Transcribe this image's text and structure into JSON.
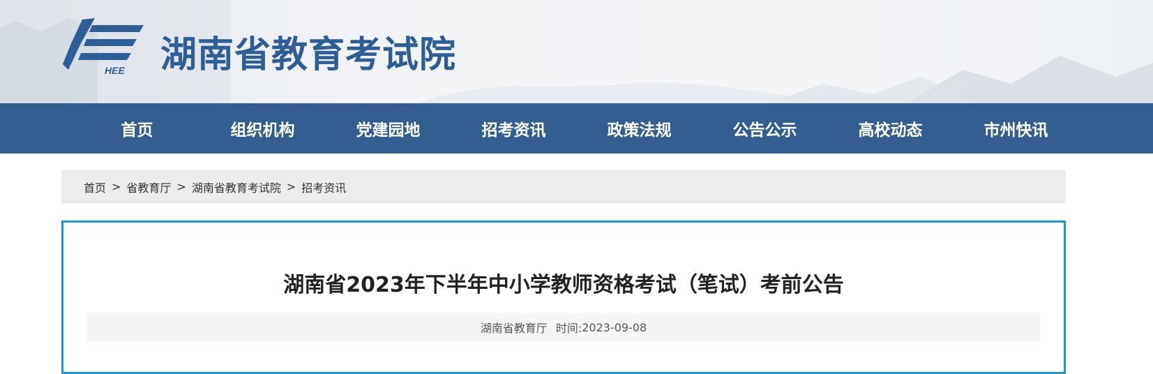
{
  "header": {
    "site_title": "湖南省教育考试院",
    "logo_text": "HEE",
    "logo_color": "#2f5e96"
  },
  "nav": {
    "items": [
      {
        "label": "首页"
      },
      {
        "label": "组织机构"
      },
      {
        "label": "党建园地"
      },
      {
        "label": "招考资讯"
      },
      {
        "label": "政策法规"
      },
      {
        "label": "公告公示"
      },
      {
        "label": "高校动态"
      },
      {
        "label": "市州快讯"
      }
    ],
    "bg_color": "#345e92"
  },
  "breadcrumb": {
    "items": [
      "首页",
      "省教育厅",
      "湖南省教育考试院",
      "招考资讯"
    ],
    "separator": ">"
  },
  "article": {
    "title": "湖南省2023年下半年中小学教师资格考试（笔试）考前公告",
    "source": "湖南省教育厅",
    "time_label": "时间:",
    "time_value": "2023-09-08",
    "border_color": "#1b9ac9"
  }
}
